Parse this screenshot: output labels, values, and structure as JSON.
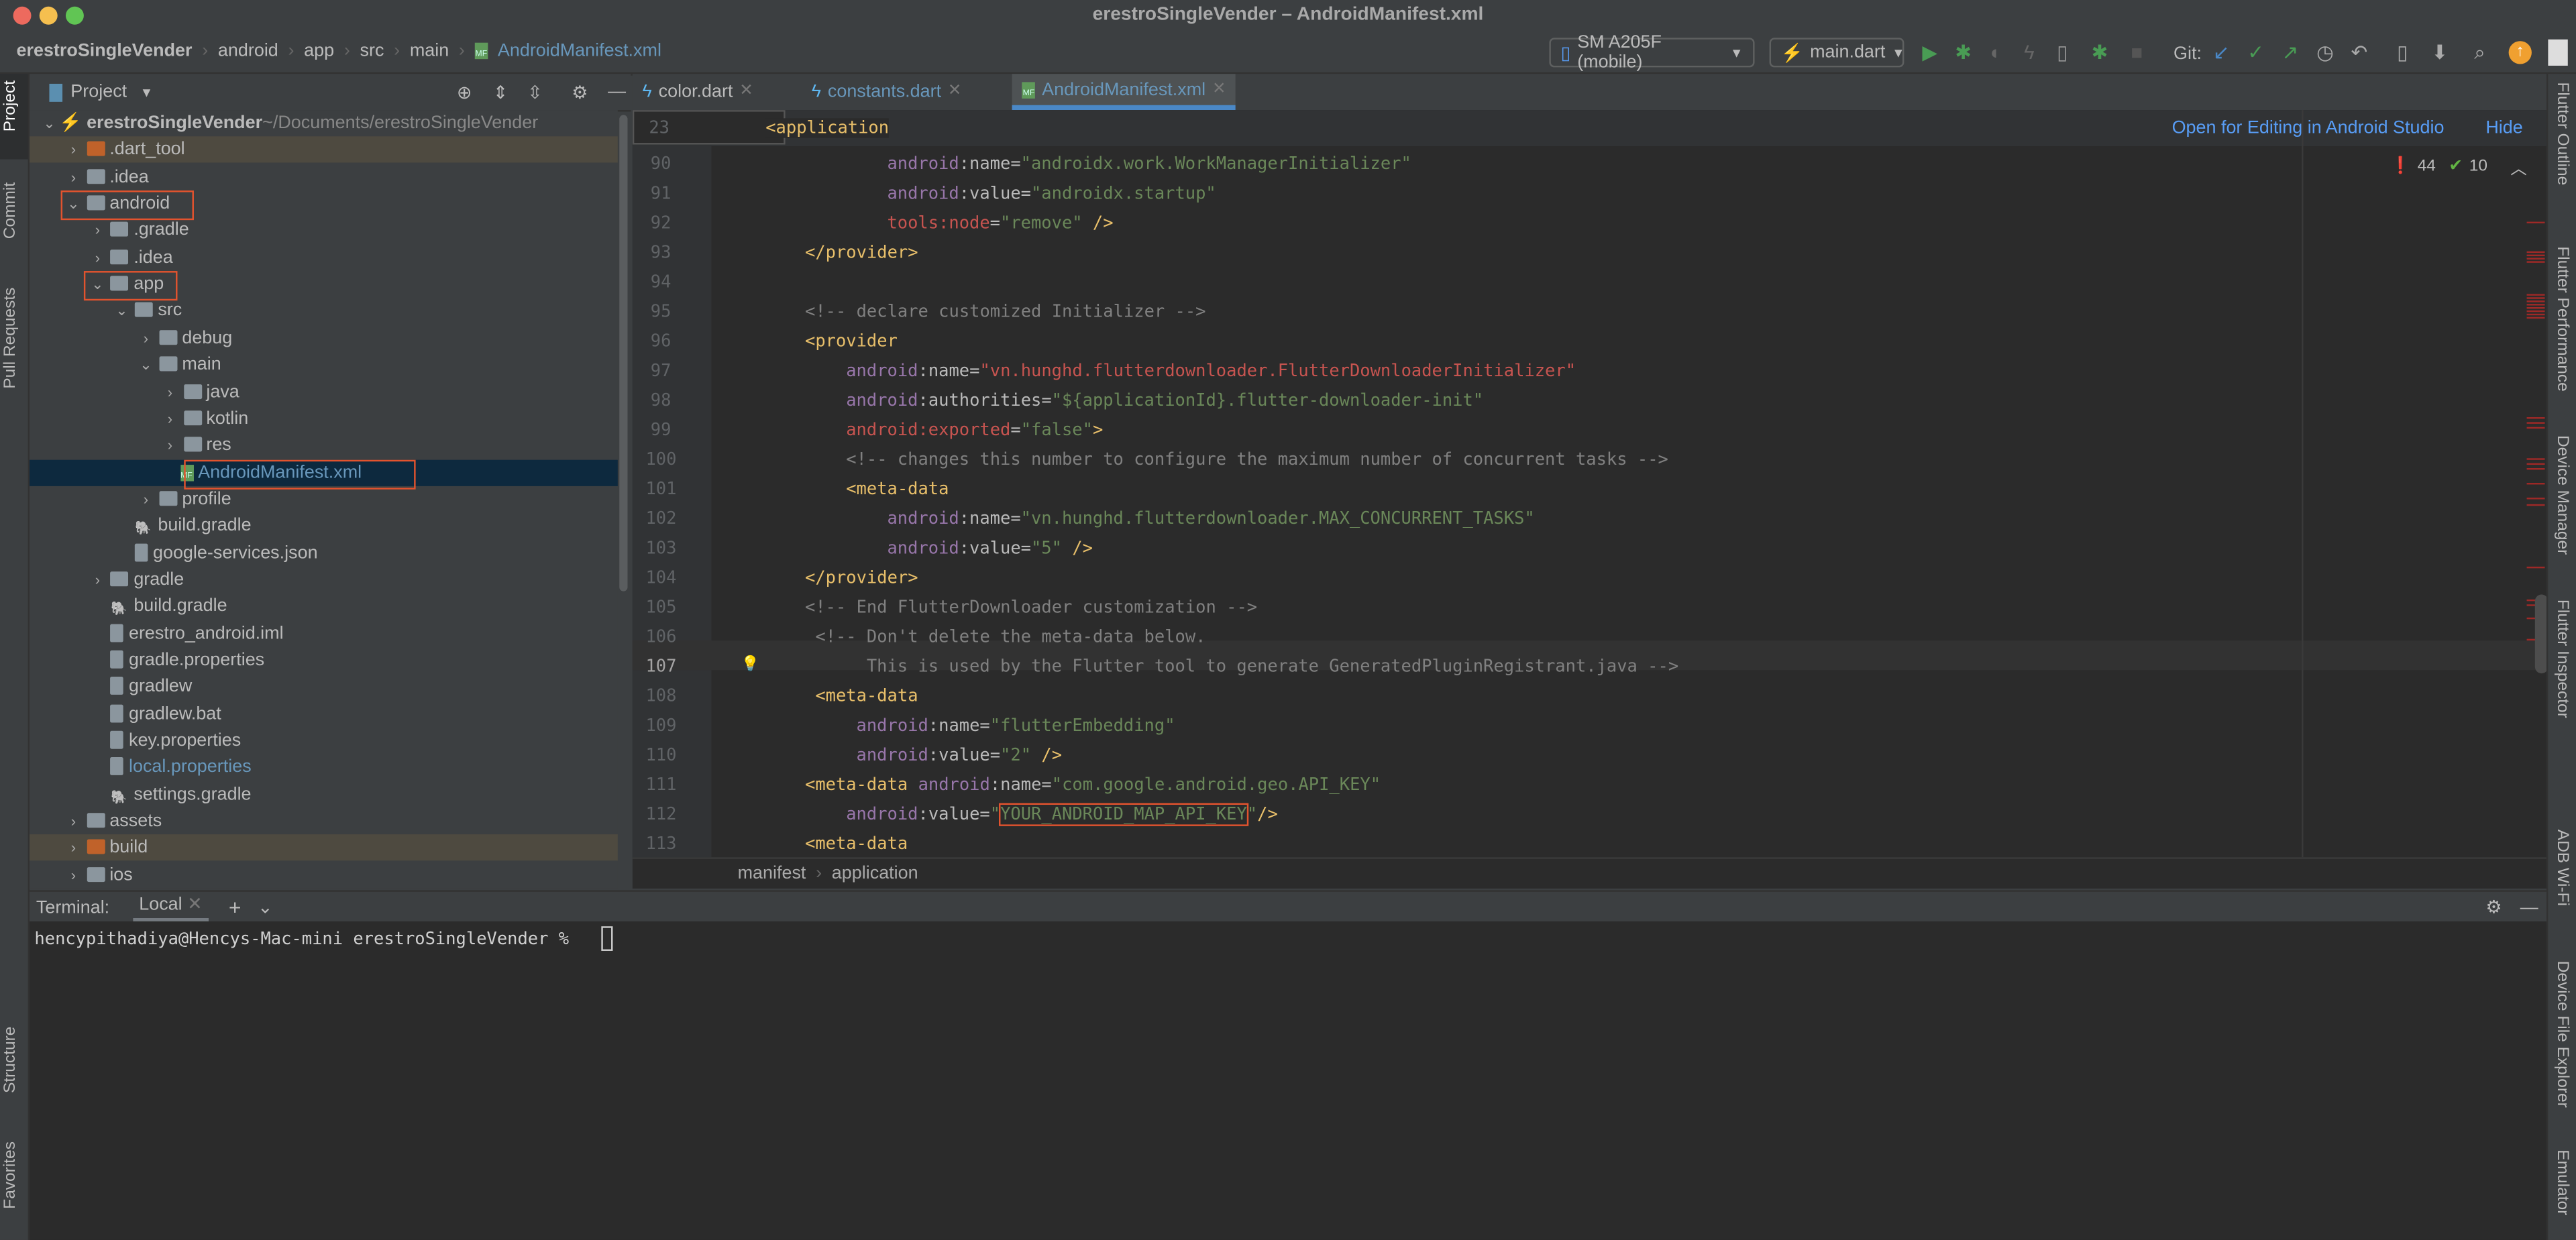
{
  "window": {
    "title": "erestroSingleVender – AndroidManifest.xml",
    "traffic_colors": [
      "#ed6a5e",
      "#f5bf4f",
      "#61c554"
    ]
  },
  "breadcrumb": [
    "erestroSingleVender",
    "android",
    "app",
    "src",
    "main",
    "AndroidManifest.xml"
  ],
  "toolbar": {
    "device": "SM A205F (mobile)",
    "run_config": "main.dart",
    "git_label": "Git:"
  },
  "left_strip": [
    "Project",
    "Commit",
    "Pull Requests",
    "Structure",
    "Favorites"
  ],
  "right_strip": [
    "Flutter Outline",
    "Flutter Performance",
    "Device Manager",
    "Flutter Inspector",
    "ADB Wi-Fi",
    "Device File Explorer",
    "Emulator"
  ],
  "project": {
    "title": "Project",
    "tree": [
      {
        "label": "erestroSingleVender",
        "suffix": "~/Documents/erestroSingleVender",
        "depth": 0,
        "chev": "open",
        "icon": "flutter",
        "bold": true
      },
      {
        "label": ".dart_tool",
        "depth": 1,
        "chev": "closed",
        "icon": "folder-orange",
        "hl": true
      },
      {
        "label": ".idea",
        "depth": 1,
        "chev": "closed",
        "icon": "folder"
      },
      {
        "label": "android",
        "depth": 1,
        "chev": "open",
        "icon": "folder",
        "boxed": true
      },
      {
        "label": ".gradle",
        "depth": 2,
        "chev": "closed",
        "icon": "folder"
      },
      {
        "label": ".idea",
        "depth": 2,
        "chev": "closed",
        "icon": "folder"
      },
      {
        "label": "app",
        "depth": 2,
        "chev": "open",
        "icon": "folder",
        "boxed": true
      },
      {
        "label": "src",
        "depth": 3,
        "chev": "open",
        "icon": "folder"
      },
      {
        "label": "debug",
        "depth": 4,
        "chev": "closed",
        "icon": "folder"
      },
      {
        "label": "main",
        "depth": 4,
        "chev": "open",
        "icon": "folder"
      },
      {
        "label": "java",
        "depth": 5,
        "chev": "closed",
        "icon": "folder"
      },
      {
        "label": "kotlin",
        "depth": 5,
        "chev": "closed",
        "icon": "folder"
      },
      {
        "label": "res",
        "depth": 5,
        "chev": "closed",
        "icon": "folder"
      },
      {
        "label": "AndroidManifest.xml",
        "depth": 5,
        "chev": "none",
        "icon": "manifest",
        "selected": true,
        "boxed": true,
        "color": "#6897bb"
      },
      {
        "label": "profile",
        "depth": 4,
        "chev": "closed",
        "icon": "folder"
      },
      {
        "label": "build.gradle",
        "depth": 3,
        "chev": "none",
        "icon": "gradle"
      },
      {
        "label": "google-services.json",
        "depth": 3,
        "chev": "none",
        "icon": "file"
      },
      {
        "label": "gradle",
        "depth": 2,
        "chev": "closed",
        "icon": "folder"
      },
      {
        "label": "build.gradle",
        "depth": 2,
        "chev": "none",
        "icon": "gradle"
      },
      {
        "label": "erestro_android.iml",
        "depth": 2,
        "chev": "none",
        "icon": "file"
      },
      {
        "label": "gradle.properties",
        "depth": 2,
        "chev": "none",
        "icon": "file"
      },
      {
        "label": "gradlew",
        "depth": 2,
        "chev": "none",
        "icon": "file"
      },
      {
        "label": "gradlew.bat",
        "depth": 2,
        "chev": "none",
        "icon": "file"
      },
      {
        "label": "key.properties",
        "depth": 2,
        "chev": "none",
        "icon": "file"
      },
      {
        "label": "local.properties",
        "depth": 2,
        "chev": "none",
        "icon": "file",
        "color": "#6897bb"
      },
      {
        "label": "settings.gradle",
        "depth": 2,
        "chev": "none",
        "icon": "gradle"
      },
      {
        "label": "assets",
        "depth": 1,
        "chev": "closed",
        "icon": "folder"
      },
      {
        "label": "build",
        "depth": 1,
        "chev": "closed",
        "icon": "folder-orange",
        "hl": true
      },
      {
        "label": "ios",
        "depth": 1,
        "chev": "closed",
        "icon": "folder"
      }
    ]
  },
  "tabs": [
    {
      "label": "color.dart",
      "color": "#bbbbbb"
    },
    {
      "label": "constants.dart",
      "color": "#6897bb"
    },
    {
      "label": "AndroidManifest.xml",
      "color": "#6897bb",
      "active": true
    }
  ],
  "editor": {
    "banner_link": "Open for Editing in Android Studio",
    "banner_hide": "Hide",
    "errors": "44",
    "warnings": "10",
    "sticky": {
      "line": "23",
      "text": "<application"
    },
    "current_line": "107",
    "lines": [
      {
        "n": "90",
        "i": 12,
        "t": [
          [
            "android",
            "ns"
          ],
          [
            ":name=",
            "attr"
          ],
          [
            "\"androidx.work.WorkManagerInitializer\"",
            "val"
          ]
        ]
      },
      {
        "n": "91",
        "i": 12,
        "t": [
          [
            "android",
            "ns"
          ],
          [
            ":value=",
            "attr"
          ],
          [
            "\"androidx.startup\"",
            "val"
          ]
        ]
      },
      {
        "n": "92",
        "i": 12,
        "t": [
          [
            "tools:node",
            "err"
          ],
          [
            "=",
            "attr"
          ],
          [
            "\"remove\"",
            "val"
          ],
          [
            " />",
            "tag"
          ]
        ]
      },
      {
        "n": "93",
        "i": 4,
        "t": [
          [
            "</provider>",
            "tag"
          ]
        ]
      },
      {
        "n": "94",
        "i": 0,
        "t": []
      },
      {
        "n": "95",
        "i": 4,
        "t": [
          [
            "<!-- declare customized Initializer -->",
            "com"
          ]
        ]
      },
      {
        "n": "96",
        "i": 4,
        "t": [
          [
            "<provider",
            "tag"
          ]
        ]
      },
      {
        "n": "97",
        "i": 8,
        "t": [
          [
            "android",
            "ns"
          ],
          [
            ":name=",
            "attr"
          ],
          [
            "\"vn.hunghd.flutterdownloader.FlutterDownloaderInitializer\"",
            "err"
          ]
        ]
      },
      {
        "n": "98",
        "i": 8,
        "t": [
          [
            "android",
            "ns"
          ],
          [
            ":authorities=",
            "attr"
          ],
          [
            "\"${applicationId}.flutter-downloader-init\"",
            "val"
          ]
        ]
      },
      {
        "n": "99",
        "i": 8,
        "t": [
          [
            "android:exported",
            "err"
          ],
          [
            "=",
            "attr"
          ],
          [
            "\"false\"",
            "val"
          ],
          [
            ">",
            "tag"
          ]
        ]
      },
      {
        "n": "100",
        "i": 8,
        "t": [
          [
            "<!-- changes this number to configure the maximum number of concurrent tasks -->",
            "com"
          ]
        ]
      },
      {
        "n": "101",
        "i": 8,
        "t": [
          [
            "<meta-data",
            "tag"
          ]
        ]
      },
      {
        "n": "102",
        "i": 12,
        "t": [
          [
            "android",
            "ns"
          ],
          [
            ":name=",
            "attr"
          ],
          [
            "\"vn.hunghd.flutterdownloader.MAX_CONCURRENT_TASKS\"",
            "val"
          ]
        ]
      },
      {
        "n": "103",
        "i": 12,
        "t": [
          [
            "android",
            "ns"
          ],
          [
            ":value=",
            "attr"
          ],
          [
            "\"5\"",
            "val"
          ],
          [
            " />",
            "tag"
          ]
        ]
      },
      {
        "n": "104",
        "i": 4,
        "t": [
          [
            "</provider>",
            "tag"
          ]
        ]
      },
      {
        "n": "105",
        "i": 4,
        "t": [
          [
            "<!-- End FlutterDownloader customization -->",
            "com"
          ]
        ]
      },
      {
        "n": "106",
        "i": 5,
        "t": [
          [
            "<!-- Don't delete the meta-data below.",
            "com"
          ]
        ]
      },
      {
        "n": "107",
        "i": 10,
        "t": [
          [
            "This is used by the Flutter tool to generate GeneratedPluginRegistrant.java -->",
            "com"
          ]
        ]
      },
      {
        "n": "108",
        "i": 5,
        "t": [
          [
            "<meta-data",
            "tag"
          ]
        ]
      },
      {
        "n": "109",
        "i": 9,
        "t": [
          [
            "android",
            "ns"
          ],
          [
            ":name=",
            "attr"
          ],
          [
            "\"flutterEmbedding\"",
            "val"
          ]
        ]
      },
      {
        "n": "110",
        "i": 9,
        "t": [
          [
            "android",
            "ns"
          ],
          [
            ":value=",
            "attr"
          ],
          [
            "\"2\"",
            "val"
          ],
          [
            " />",
            "tag"
          ]
        ]
      },
      {
        "n": "111",
        "i": 4,
        "t": [
          [
            "<meta-data ",
            "tag"
          ],
          [
            "android",
            "ns"
          ],
          [
            ":name=",
            "attr"
          ],
          [
            "\"com.google.android.geo.API_KEY\"",
            "val"
          ]
        ]
      },
      {
        "n": "112",
        "i": 8,
        "t": [
          [
            "android",
            "ns"
          ],
          [
            ":value=",
            "attr"
          ],
          [
            "\"",
            "val"
          ],
          [
            "YOUR_ANDROID_MAP_API_KEY",
            "val"
          ],
          [
            "\"",
            "val"
          ],
          [
            "/>",
            "tag"
          ]
        ]
      },
      {
        "n": "113",
        "i": 4,
        "t": [
          [
            "<meta-data",
            "tag"
          ]
        ]
      }
    ],
    "breadcrumb": [
      "manifest",
      "application"
    ]
  },
  "terminal": {
    "label": "Terminal:",
    "tab": "Local",
    "prompt": "hencypithadiya@Hencys-Mac-mini erestroSingleVender % "
  }
}
